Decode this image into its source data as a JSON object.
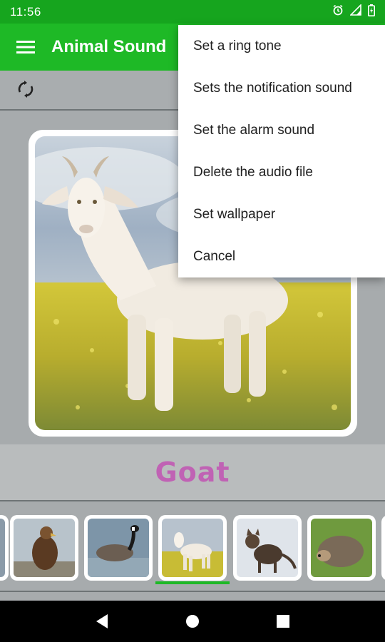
{
  "status_bar": {
    "time": "11:56",
    "icons": [
      "alarm-icon",
      "signal-icon",
      "battery-icon"
    ]
  },
  "app_bar": {
    "title": "Animal Sound",
    "menu_icon": "hamburger-menu-icon"
  },
  "toolbar": {
    "refresh_icon": "refresh-icon"
  },
  "main": {
    "animal_name": "Goat",
    "name_color": "#c062b4"
  },
  "thumbnails": [
    {
      "animal": "eagle",
      "selected": false
    },
    {
      "animal": "goose",
      "selected": false
    },
    {
      "animal": "goat",
      "selected": true
    },
    {
      "animal": "cat",
      "selected": false
    },
    {
      "animal": "hedgehog",
      "selected": false
    }
  ],
  "popup_menu": {
    "items": [
      "Set a ring tone",
      "Sets the notification sound",
      "Set the alarm sound",
      "Delete the audio file",
      "Set wallpaper",
      "Cancel"
    ]
  },
  "nav_bar": {
    "icons": [
      "back-icon",
      "home-icon",
      "recents-icon"
    ]
  },
  "colors": {
    "accent": "#1eb926",
    "status_bar": "#16a51e",
    "background": "#a7abad"
  }
}
